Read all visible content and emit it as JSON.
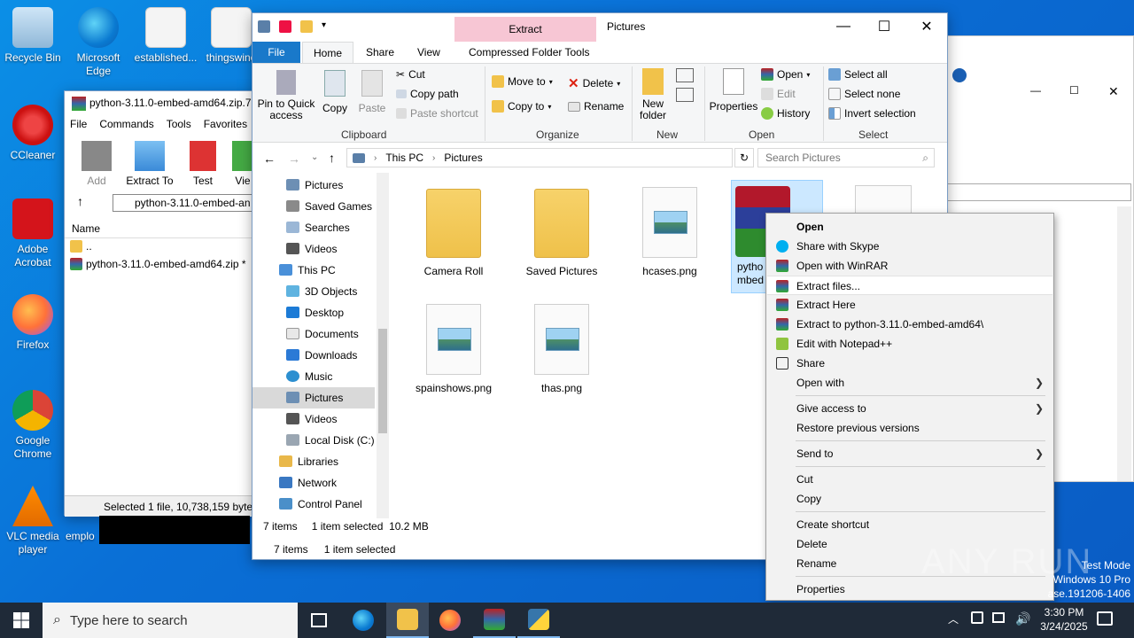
{
  "desktop": {
    "icons": [
      {
        "label": "Recycle Bin"
      },
      {
        "label": "Microsoft Edge"
      },
      {
        "label": "established..."
      },
      {
        "label": "thingswine"
      },
      {
        "label": "CCleaner"
      },
      {
        "label": "Adobe Acrobat"
      },
      {
        "label": "Firefox"
      },
      {
        "label": "Google Chrome"
      },
      {
        "label": "VLC media player"
      },
      {
        "label": "emplo"
      }
    ],
    "watermark": "ANY RUN",
    "os_info": {
      "line1": "Test Mode",
      "line2": "Windows 10 Pro",
      "line3": "ase.191206-1406"
    }
  },
  "winrar": {
    "title": "python-3.11.0-embed-amd64.zip.7",
    "menu": [
      "File",
      "Commands",
      "Tools",
      "Favorites"
    ],
    "toolbar": [
      "Add",
      "Extract To",
      "Test",
      "Vie"
    ],
    "path": "python-3.11.0-embed-an",
    "column_name": "Name",
    "rows": [
      "..",
      "python-3.11.0-embed-amd64.zip *"
    ],
    "status": "Selected 1 file, 10,738,159 bytes"
  },
  "explorer": {
    "title": "Pictures",
    "extract_tab": "Extract",
    "tabs": [
      "File",
      "Home",
      "Share",
      "View",
      "Compressed Folder Tools"
    ],
    "ribbon": {
      "clipboard": {
        "label": "Clipboard",
        "pin": "Pin to Quick access",
        "copy": "Copy",
        "paste": "Paste",
        "cut": "Cut",
        "copy_path": "Copy path",
        "paste_shortcut": "Paste shortcut"
      },
      "organize": {
        "label": "Organize",
        "move_to": "Move to",
        "copy_to": "Copy to",
        "delete": "Delete",
        "rename": "Rename"
      },
      "new": {
        "label": "New",
        "new_folder": "New folder"
      },
      "open": {
        "label": "Open",
        "properties": "Properties",
        "open": "Open",
        "edit": "Edit",
        "history": "History"
      },
      "select": {
        "label": "Select",
        "select_all": "Select all",
        "select_none": "Select none",
        "invert": "Invert selection"
      }
    },
    "address": {
      "parts": [
        "This PC",
        "Pictures"
      ]
    },
    "search_placeholder": "Search Pictures",
    "nav": [
      "Pictures",
      "Saved Games",
      "Searches",
      "Videos",
      "This PC",
      "3D Objects",
      "Desktop",
      "Documents",
      "Downloads",
      "Music",
      "Pictures",
      "Videos",
      "Local Disk (C:)",
      "Libraries",
      "Network",
      "Control Panel"
    ],
    "files": [
      "Camera Roll",
      "Saved Pictures",
      "hcases.png",
      "pytho mbed",
      "spainshows.png",
      "thas.png"
    ],
    "status": {
      "count": "7 items",
      "selected": "1 item selected",
      "size": "10.2 MB"
    },
    "status2": {
      "count": "7 items",
      "selected": "1 item selected"
    }
  },
  "context_menu": {
    "items": [
      "Open",
      "Share with Skype",
      "Open with WinRAR",
      "Extract files...",
      "Extract Here",
      "Extract to python-3.11.0-embed-amd64\\",
      "Edit with Notepad++",
      "Share",
      "Open with",
      "Give access to",
      "Restore previous versions",
      "Send to",
      "Cut",
      "Copy",
      "Create shortcut",
      "Delete",
      "Rename",
      "Properties"
    ]
  },
  "taskbar": {
    "search_placeholder": "Type here to search",
    "time": "3:30 PM",
    "date": "3/24/2025"
  }
}
